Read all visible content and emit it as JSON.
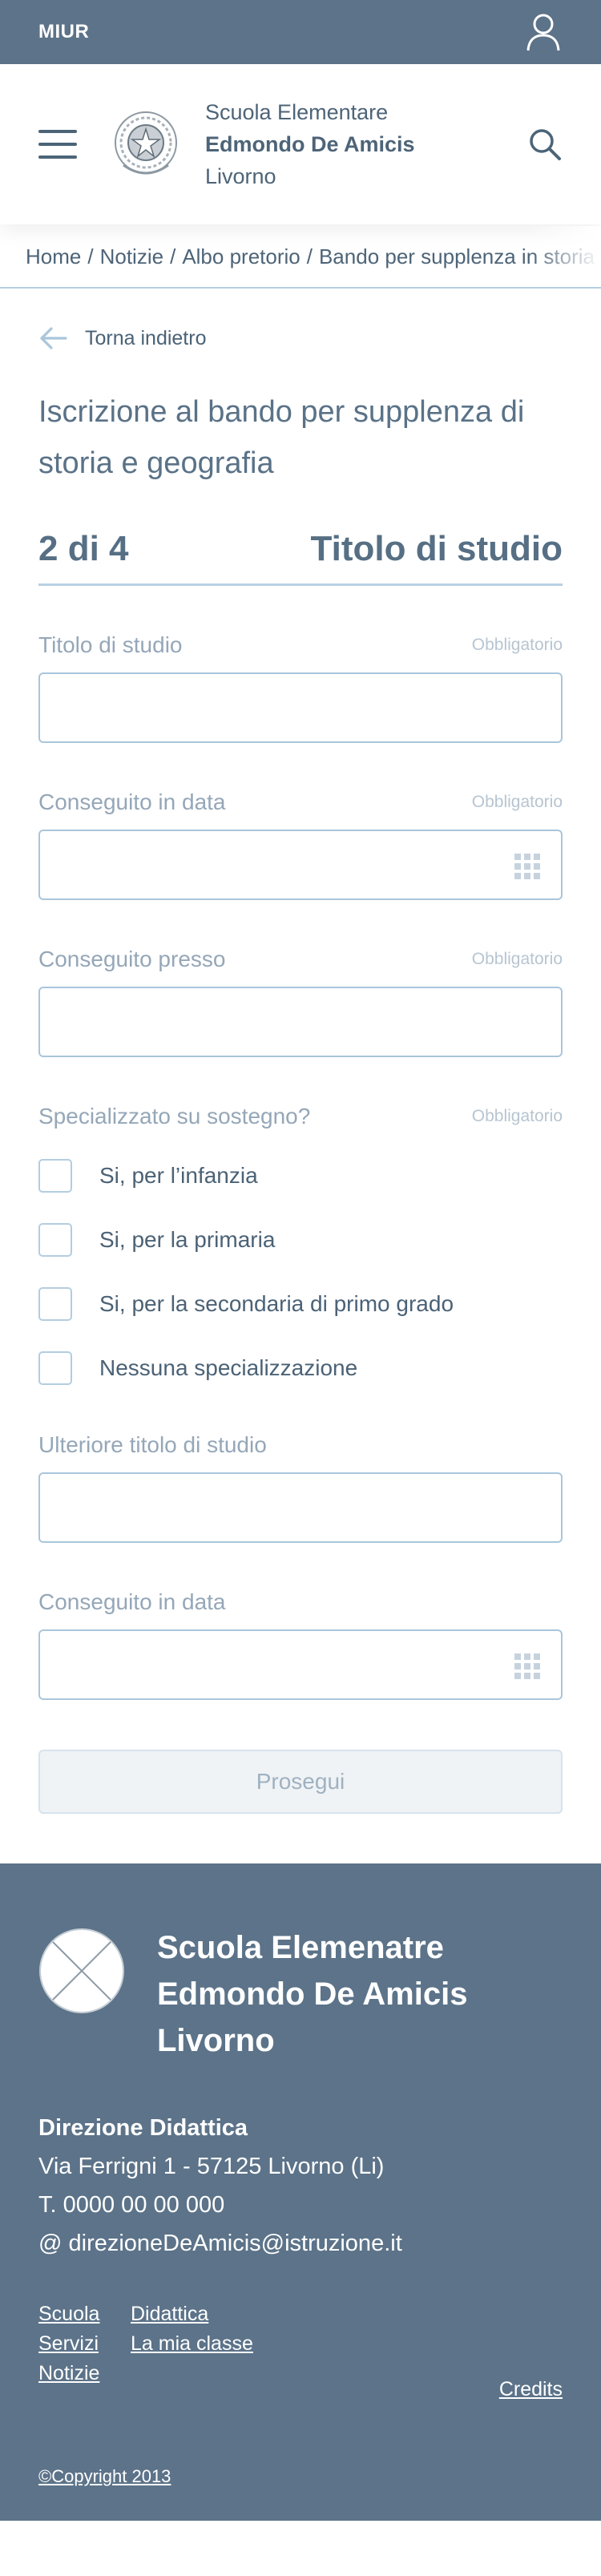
{
  "topbar": {
    "brand": "MIUR",
    "user_icon": "user-icon"
  },
  "header": {
    "menu_icon": "hamburger-icon",
    "emblem": "republic-emblem-icon",
    "school_line1": "Scuola Elementare",
    "school_line2": "Edmondo De Amicis",
    "school_line3": "Livorno",
    "search_icon": "search-icon"
  },
  "breadcrumb": {
    "items": [
      "Home",
      "Notizie",
      "Albo pretorio",
      "Bando per supplenza in storia e geografia"
    ],
    "separator": "/"
  },
  "back": {
    "label": "Torna indietro",
    "icon": "arrow-left-icon"
  },
  "page_title": "Iscrizione al bando per supplenza di storia e geografia",
  "stepper": {
    "count": "2 di 4",
    "name": "Titolo di studio"
  },
  "required_label": "Obbligatorio",
  "fields": {
    "titolo": {
      "label": "Titolo di studio",
      "value": ""
    },
    "data": {
      "label": "Conseguito in data",
      "value": "",
      "icon": "calendar-icon"
    },
    "presso": {
      "label": "Conseguito presso",
      "value": ""
    },
    "ulteriore": {
      "label": "Ulteriore titolo di studio",
      "value": ""
    },
    "data2": {
      "label": "Conseguito in data",
      "value": "",
      "icon": "calendar-icon"
    }
  },
  "sostegno": {
    "label": "Specializzato su sostegno?",
    "options": [
      {
        "label": "Si, per l’infanzia",
        "checked": false
      },
      {
        "label": "Si, per la primaria",
        "checked": false
      },
      {
        "label": "Si, per la secondaria di primo grado",
        "checked": false
      },
      {
        "label": "Nessuna specializzazione",
        "checked": false
      }
    ]
  },
  "submit_label": "Prosegui",
  "footer": {
    "logo_icon": "logo-placeholder-icon",
    "name_line1": "Scuola Elemenatre",
    "name_line2": "Edmondo De Amicis",
    "name_line3": "Livorno",
    "direction": "Direzione Didattica",
    "address": "Via Ferrigni 1 - 57125 Livorno (Li)",
    "phone": "T. 0000 00 00 000",
    "email": "@ direzioneDeAmicis@istruzione.it",
    "links": [
      "Scuola",
      "Didattica",
      "Servizi",
      "La mia classe",
      "Notizie"
    ],
    "credits": "Credits",
    "copyright": "©Copyright 2013"
  },
  "colors": {
    "primary": "#5c7389",
    "border": "#a9c6dc",
    "muted": "#95a7b8"
  }
}
